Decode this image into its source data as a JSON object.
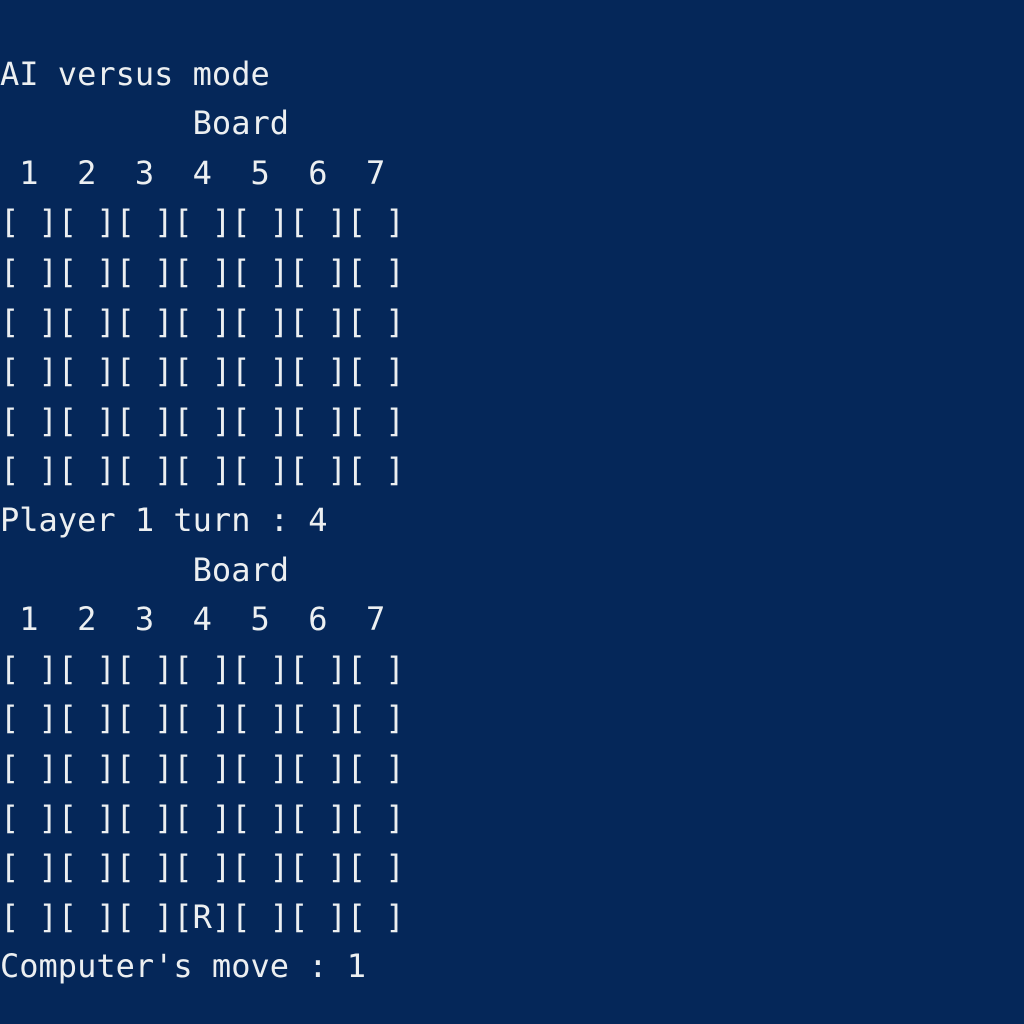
{
  "mode_line": "AI versus mode",
  "board_label": "          Board",
  "column_header": " 1  2  3  4  5  6  7",
  "board1": {
    "rows": [
      [
        " ",
        " ",
        " ",
        " ",
        " ",
        " ",
        " "
      ],
      [
        " ",
        " ",
        " ",
        " ",
        " ",
        " ",
        " "
      ],
      [
        " ",
        " ",
        " ",
        " ",
        " ",
        " ",
        " "
      ],
      [
        " ",
        " ",
        " ",
        " ",
        " ",
        " ",
        " "
      ],
      [
        " ",
        " ",
        " ",
        " ",
        " ",
        " ",
        " "
      ],
      [
        " ",
        " ",
        " ",
        " ",
        " ",
        " ",
        " "
      ]
    ]
  },
  "prompt1": {
    "label": "Player 1 turn : ",
    "value": "4"
  },
  "board2": {
    "rows": [
      [
        " ",
        " ",
        " ",
        " ",
        " ",
        " ",
        " "
      ],
      [
        " ",
        " ",
        " ",
        " ",
        " ",
        " ",
        " "
      ],
      [
        " ",
        " ",
        " ",
        " ",
        " ",
        " ",
        " "
      ],
      [
        " ",
        " ",
        " ",
        " ",
        " ",
        " ",
        " "
      ],
      [
        " ",
        " ",
        " ",
        " ",
        " ",
        " ",
        " "
      ],
      [
        " ",
        " ",
        " ",
        "R",
        " ",
        " ",
        " "
      ]
    ]
  },
  "prompt2": {
    "label": "Computer's move : ",
    "value": "1"
  }
}
